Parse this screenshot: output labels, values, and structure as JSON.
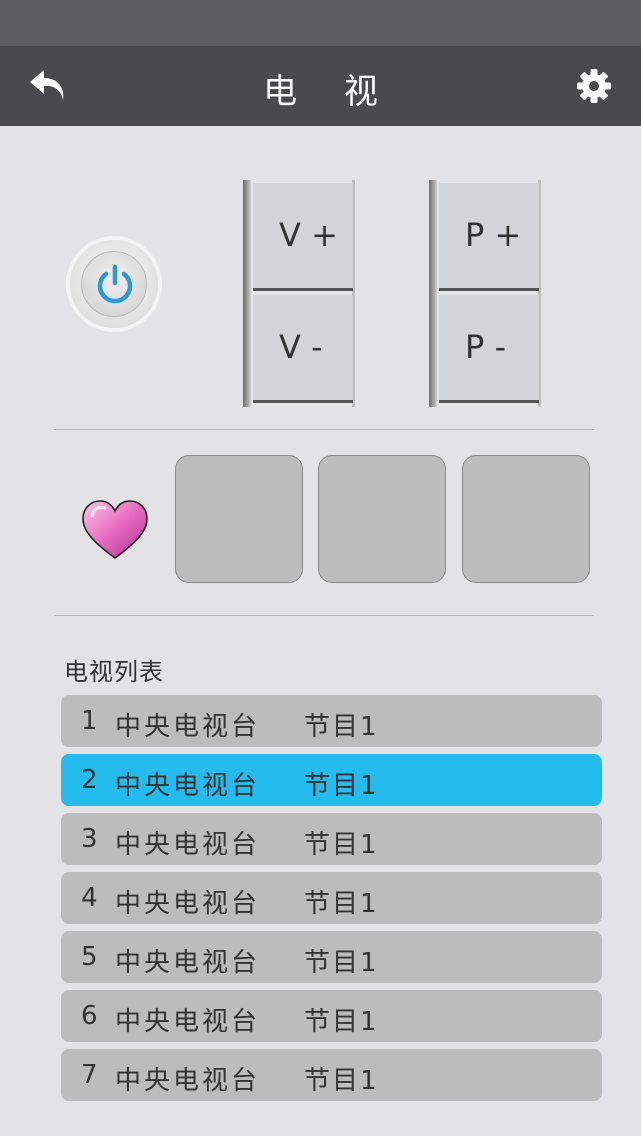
{
  "header": {
    "title": "电 视",
    "back_icon": "back-arrow-icon",
    "settings_icon": "gear-icon"
  },
  "remote": {
    "power_icon": "power-icon",
    "volume_up": "V +",
    "volume_down": "V -",
    "program_up": "P +",
    "program_down": "P -"
  },
  "favorites": {
    "icon": "heart-icon",
    "slots": [
      "",
      "",
      ""
    ]
  },
  "channel_list": {
    "title": "电视列表",
    "items": [
      {
        "index": "1",
        "channel": "中央电视台",
        "program": "节目1"
      },
      {
        "index": "2",
        "channel": "中央电视台",
        "program": "节目1"
      },
      {
        "index": "3",
        "channel": "中央电视台",
        "program": "节目1"
      },
      {
        "index": "4",
        "channel": "中央电视台",
        "program": "节目1"
      },
      {
        "index": "5",
        "channel": "中央电视台",
        "program": "节目1"
      },
      {
        "index": "6",
        "channel": "中央电视台",
        "program": "节目1"
      },
      {
        "index": "7",
        "channel": "中央电视台",
        "program": "节目1"
      }
    ],
    "selected_index": 2
  },
  "colors": {
    "nav_bar": "#4a4a4c",
    "status_bar": "#5e5e60",
    "background": "#e3e3e6",
    "row": "#bcbcbc",
    "row_selected": "#24bbef",
    "power_blue": "#2b9ad6",
    "heart_pink": "#e86ac0"
  }
}
